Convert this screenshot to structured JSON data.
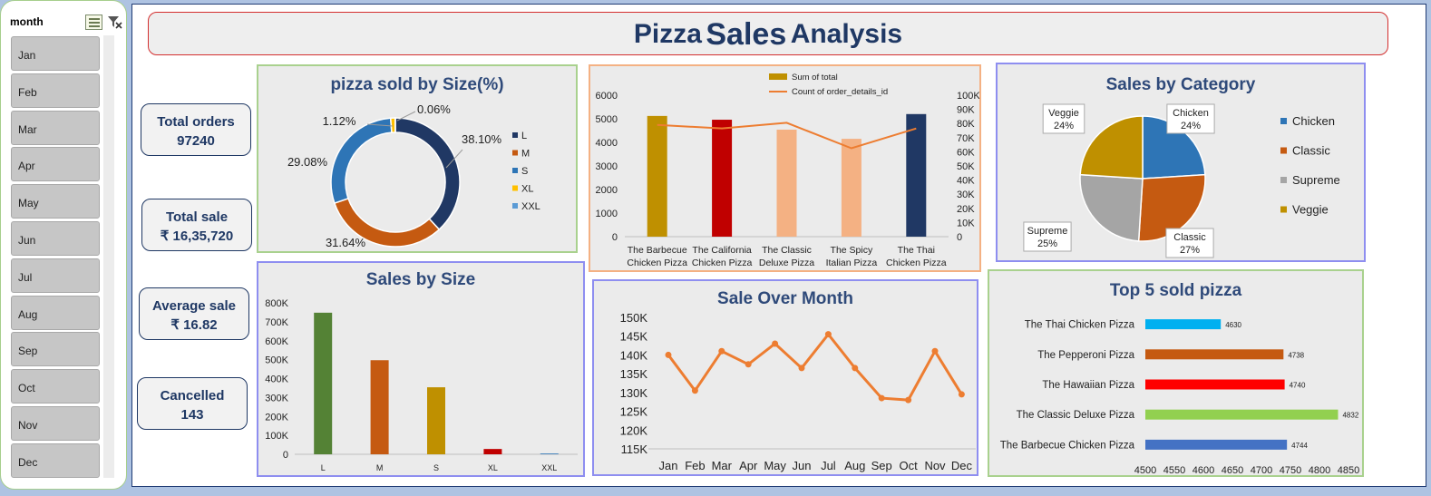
{
  "slicer": {
    "title": "month",
    "items": [
      "Jan",
      "Feb",
      "Mar",
      "Apr",
      "May",
      "Jun",
      "Jul",
      "Aug",
      "Sep",
      "Oct",
      "Nov",
      "Dec"
    ]
  },
  "header": {
    "title_part1": "Pizza",
    "title_part2": "Sales",
    "title_part3": "Analysis"
  },
  "kpis": {
    "total_orders": {
      "label": "Total orders",
      "value": "97240"
    },
    "total_sale": {
      "label": "Total sale",
      "value": "₹ 16,35,720"
    },
    "average_sale": {
      "label": "Average sale",
      "value": "₹ 16.82"
    },
    "cancelled": {
      "label": "Cancelled",
      "value": "143"
    }
  },
  "colors": {
    "panel_bg": "#ebebeb",
    "title": "#1f3864",
    "size_L": "#203864",
    "size_M": "#c55a11",
    "size_S": "#2e75b6",
    "size_XL": "#ffc000",
    "size_XXL": "#5b9bd5"
  },
  "chart_data": [
    {
      "id": "size_donut",
      "type": "pie",
      "title": "pizza sold by Size(%)",
      "labels": [
        "L",
        "M",
        "S",
        "XL",
        "XXL"
      ],
      "values": [
        38.1,
        31.64,
        29.08,
        1.12,
        0.06
      ],
      "data_labels": [
        "38.10%",
        "31.64%",
        "29.08%",
        "1.12%",
        "0.06%"
      ],
      "colors": [
        "#203864",
        "#c55a11",
        "#2e75b6",
        "#ffc000",
        "#5b9bd5"
      ],
      "legend": "right"
    },
    {
      "id": "combo",
      "type": "bar",
      "categories": [
        "The Barbecue Chicken Pizza",
        "The California Chicken Pizza",
        "The Classic Deluxe Pizza",
        "The Spicy Italian Pizza",
        "The Thai Chicken Pizza"
      ],
      "series": [
        {
          "name": "Sum of total",
          "type": "bar",
          "values": [
            5120,
            4960,
            4540,
            4150,
            5200
          ],
          "colors": [
            "#bf9000",
            "#c00000",
            "#f4b183",
            "#f4b183",
            "#203864"
          ]
        },
        {
          "name": "Count of order_details_id",
          "type": "line",
          "axis": "right",
          "values": [
            79000,
            76500,
            80500,
            62500,
            76500
          ],
          "color": "#ed7d31"
        }
      ],
      "ylim": [
        0,
        6000
      ],
      "y_ticks": [
        "0",
        "1000",
        "2000",
        "3000",
        "4000",
        "5000",
        "6000"
      ],
      "y2lim": [
        0,
        100000
      ],
      "y2_ticks": [
        "0",
        "10K",
        "20K",
        "30K",
        "40K",
        "50K",
        "60K",
        "70K",
        "80K",
        "90K",
        "100K"
      ],
      "legend": "top"
    },
    {
      "id": "category_pie",
      "type": "pie",
      "title": "Sales by Category",
      "labels": [
        "Chicken",
        "Classic",
        "Supreme",
        "Veggie"
      ],
      "values": [
        24,
        27,
        25,
        24
      ],
      "data_labels": [
        "24%",
        "27%",
        "25%",
        "24%"
      ],
      "colors": [
        "#2e75b6",
        "#c55a11",
        "#a5a5a5",
        "#bf9000"
      ],
      "legend": "right"
    },
    {
      "id": "sales_by_size",
      "type": "bar",
      "title": "Sales by Size",
      "categories": [
        "L",
        "M",
        "S",
        "XL",
        "XXL"
      ],
      "values": [
        748000,
        497000,
        354000,
        28000,
        4000
      ],
      "colors": [
        "#548235",
        "#c55a11",
        "#bf9000",
        "#c00000",
        "#2e75b6"
      ],
      "ylim": [
        0,
        800000
      ],
      "y_ticks": [
        "0",
        "100K",
        "200K",
        "300K",
        "400K",
        "500K",
        "600K",
        "700K",
        "800K"
      ]
    },
    {
      "id": "sale_over_month",
      "type": "line",
      "title": "Sale Over Month",
      "categories": [
        "Jan",
        "Feb",
        "Mar",
        "Apr",
        "May",
        "Jun",
        "Jul",
        "Aug",
        "Sep",
        "Oct",
        "Nov",
        "Dec"
      ],
      "values": [
        140000,
        130500,
        141000,
        137500,
        143000,
        136500,
        145500,
        136500,
        128500,
        128000,
        141000,
        129500
      ],
      "color": "#ed7d31",
      "ylim": [
        115000,
        150000
      ],
      "y_ticks": [
        "115K",
        "120K",
        "125K",
        "130K",
        "135K",
        "140K",
        "145K",
        "150K"
      ]
    },
    {
      "id": "top5",
      "type": "bar",
      "orientation": "horizontal",
      "title": "Top 5 sold pizza",
      "categories": [
        "The Thai Chicken Pizza",
        "The Pepperoni Pizza",
        "The Hawaiian Pizza",
        "The Classic Deluxe Pizza",
        "The Barbecue Chicken Pizza"
      ],
      "values": [
        4630,
        4738,
        4740,
        4832,
        4744
      ],
      "data_labels": [
        "4630",
        "4738",
        "4740",
        "4832",
        "4744"
      ],
      "colors": [
        "#00b0f0",
        "#c55a11",
        "#ff0000",
        "#92d050",
        "#4472c4"
      ],
      "xlim": [
        4500,
        4850
      ],
      "x_ticks": [
        "4500",
        "4550",
        "4600",
        "4650",
        "4700",
        "4750",
        "4800",
        "4850"
      ]
    }
  ]
}
